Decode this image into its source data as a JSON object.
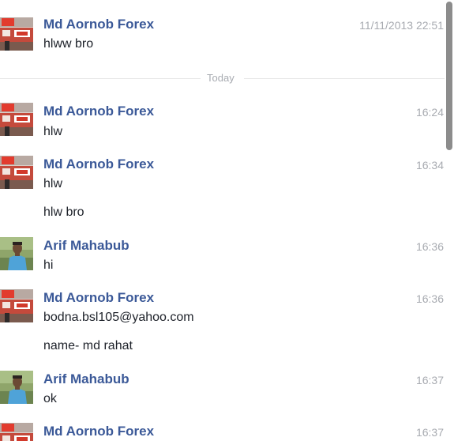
{
  "thread": {
    "earlier": {
      "sender": "Md Aornob Forex",
      "time": "11/11/2013 22:51",
      "messages": [
        "hlww bro"
      ]
    },
    "divider_label": "Today",
    "groups": [
      {
        "sender": "Md Aornob Forex",
        "time": "16:24",
        "avatar": "aornob-avatar",
        "messages": [
          "hlw"
        ]
      },
      {
        "sender": "Md Aornob Forex",
        "time": "16:34",
        "avatar": "aornob-avatar",
        "messages": [
          "hlw",
          "hlw bro"
        ]
      },
      {
        "sender": "Arif Mahabub",
        "time": "16:36",
        "avatar": "arif-avatar",
        "messages": [
          "hi"
        ]
      },
      {
        "sender": "Md Aornob Forex",
        "time": "16:36",
        "avatar": "aornob-avatar",
        "messages": [
          "bodna.bsl105@yahoo.com",
          "name- md rahat"
        ]
      },
      {
        "sender": "Arif Mahabub",
        "time": "16:37",
        "avatar": "arif-avatar",
        "messages": [
          "ok"
        ]
      },
      {
        "sender": "Md Aornob Forex",
        "time": "16:37",
        "avatar": "aornob-avatar",
        "messages": []
      }
    ]
  },
  "colors": {
    "sender_name": "#3b5998",
    "timestamp": "#a8abb1",
    "message_text": "#1d2129",
    "divider": "#e5e5e5",
    "scrollbar_thumb": "#8c8c8c"
  }
}
